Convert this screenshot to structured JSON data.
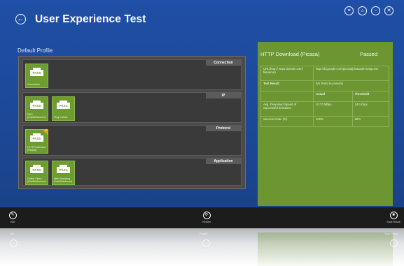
{
  "header": {
    "title": "User Experience Test",
    "back_icon": "←",
    "window_buttons": [
      "≡",
      "⌂",
      "−",
      "✕"
    ]
  },
  "profile": {
    "label": "Default Profile",
    "sections": [
      {
        "header": "Connection",
        "tiles": [
          {
            "badge": "PASS",
            "label": "Connection"
          }
        ]
      },
      {
        "header": "IP",
        "tiles": [
          {
            "badge": "PASS",
            "label": "DNS (FastWhichever)"
          },
          {
            "badge": "PASS",
            "label": "Ping Culture"
          }
        ]
      },
      {
        "header": "Protocol",
        "tiles": [
          {
            "badge": "PASS",
            "label": "HTTP Download (Picasa)"
          }
        ]
      },
      {
        "header": "Application",
        "tiles": [
          {
            "badge": "PASS",
            "label": "Online Video (FastWhichever)"
          },
          {
            "badge": "PASS",
            "label": "Web Browsing (FastWhichever)"
          }
        ]
      }
    ]
  },
  "details": {
    "title": "HTTP Download (Picasa)",
    "status": "Passed",
    "rows": {
      "url_label": "URL(http:// www.domain.com/ filename)",
      "url_value": "http://dl.google.com/picasa/picasa39-setup.exe",
      "result_label": "Test Result",
      "result_value": "5/5 Tests Successful",
      "col_actual": "Actual",
      "col_threshold": "Threshold",
      "speed_label": "Avg. Download Speed of Successful Iterations",
      "speed_actual": "10.70 Mbps",
      "speed_threshold": "142 Kbps",
      "rate_label": "Success Rate (%)",
      "rate_actual": "100%",
      "rate_threshold": "60%"
    }
  },
  "bottom_bar": {
    "edit_label": "Edit",
    "edit_icon": "✎",
    "restart_label": "Restart",
    "restart_icon": "⟳",
    "save_label": "Save Result",
    "save_icon": "■"
  },
  "reflection_labels": {
    "edit": "Edit",
    "restart": "Restart",
    "save": "Save Result"
  }
}
